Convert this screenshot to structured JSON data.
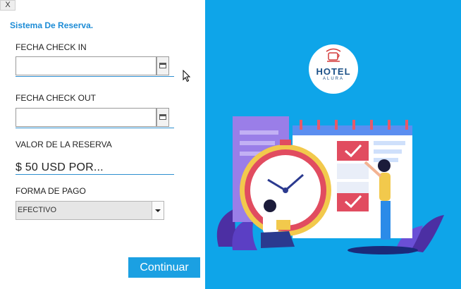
{
  "window": {
    "close_label": "X"
  },
  "form": {
    "title": "Sistema De Reserva.",
    "checkin_label": "FECHA CHECK IN",
    "checkin_value": "",
    "checkout_label": "FECHA CHECK OUT",
    "checkout_value": "",
    "valor_label": "VALOR DE LA RESERVA",
    "valor_value": "$ 50 USD POR...",
    "pago_label": "FORMA DE PAGO",
    "pago_value": "EFECTIVO",
    "continuar_label": "Continuar"
  },
  "brand": {
    "logo_name": "HOTEL",
    "logo_sub": "ALURA"
  },
  "colors": {
    "accent": "#1ba0e2",
    "panel": "#0ea5e9",
    "title": "#1d8cd6"
  }
}
